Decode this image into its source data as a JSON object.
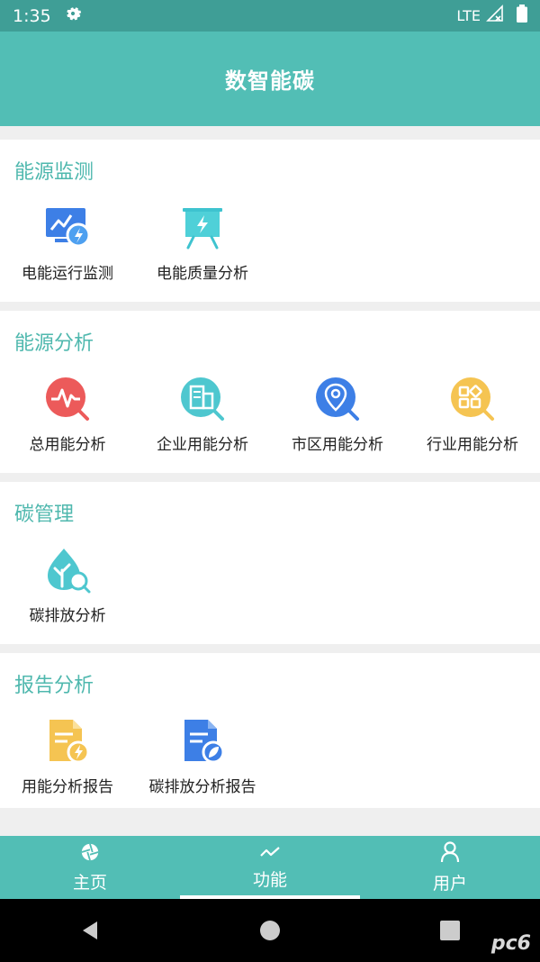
{
  "status_bar": {
    "time": "1:35",
    "network": "LTE"
  },
  "header": {
    "title": "数智能碳"
  },
  "sections": [
    {
      "title": "能源监测",
      "items": [
        {
          "label": "电能运行监测"
        },
        {
          "label": "电能质量分析"
        }
      ]
    },
    {
      "title": "能源分析",
      "items": [
        {
          "label": "总用能分析"
        },
        {
          "label": "企业用能分析"
        },
        {
          "label": "市区用能分析"
        },
        {
          "label": "行业用能分析"
        }
      ]
    },
    {
      "title": "碳管理",
      "items": [
        {
          "label": "碳排放分析"
        }
      ]
    },
    {
      "title": "报告分析",
      "items": [
        {
          "label": "用能分析报告"
        },
        {
          "label": "碳排放分析报告"
        }
      ]
    }
  ],
  "bottom_nav": {
    "active": "功能",
    "items": [
      {
        "label": "主页",
        "icon": "aperture-icon"
      },
      {
        "label": "功能",
        "icon": "trend-icon"
      },
      {
        "label": "用户",
        "icon": "user-icon"
      }
    ]
  },
  "watermark": "pc6",
  "colors": {
    "accent": "#52beb5",
    "title": "#4fb8ae"
  }
}
